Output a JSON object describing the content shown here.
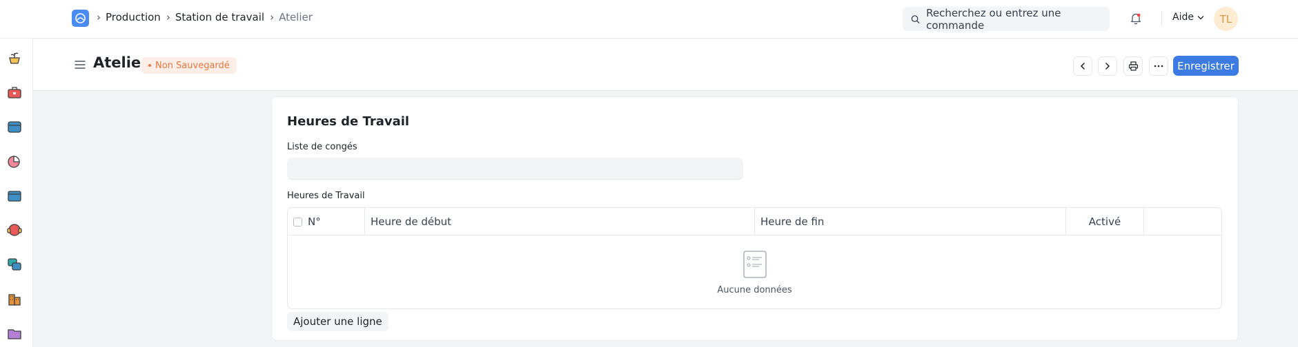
{
  "navbar": {
    "breadcrumbs": [
      {
        "label": "Production"
      },
      {
        "label": "Station de travail"
      },
      {
        "label": "Atelier"
      }
    ],
    "search_placeholder": "Recherchez ou entrez une commande",
    "help_label": "Aide",
    "avatar_initials": "TL"
  },
  "page": {
    "title": "Atelier",
    "status": "Non Sauvegardé",
    "save_label": "Enregistrer"
  },
  "form": {
    "section_title": "Heures de Travail",
    "holiday_list_label": "Liste de congés",
    "holiday_list_value": "",
    "table_label": "Heures de Travail",
    "columns": [
      "N°",
      "Heure de début",
      "Heure de fin",
      "Activé"
    ],
    "empty_text": "Aucune données",
    "add_row_label": "Ajouter une ligne"
  },
  "colors": {
    "primary": "#3c7be3",
    "status_text": "#e8763f",
    "status_bg": "#fdefe7",
    "avatar_bg": "#fdebd2"
  },
  "sidebar_icons": [
    "plant-pot-icon",
    "toolbox-icon",
    "cash-box-icon",
    "pie-chart-icon",
    "inbox-icon",
    "support-headset-icon",
    "chat-bubbles-icon",
    "buildings-icon",
    "folder-icon"
  ]
}
